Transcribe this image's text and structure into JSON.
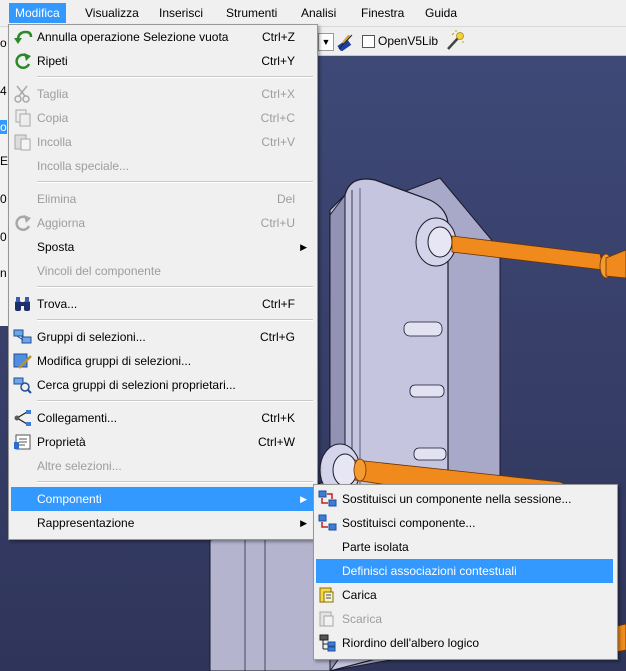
{
  "menubar": {
    "items": [
      "Modifica",
      "Visualizza",
      "Inserisci",
      "Strumenti",
      "Analisi",
      "Finestra",
      "Guida"
    ],
    "active": "Modifica"
  },
  "toolbar": {
    "checkbox_label": "OpenV5Lib",
    "checkbox_checked": false
  },
  "left_strip_chars": [
    "o",
    "4",
    "o",
    "E",
    "0",
    "0",
    "n"
  ],
  "menu": {
    "items": [
      {
        "label": "Annulla operazione Selezione vuota",
        "shortcut": "Ctrl+Z",
        "icon": "undo-icon",
        "enabled": true
      },
      {
        "label": "Ripeti",
        "shortcut": "Ctrl+Y",
        "icon": "redo-icon",
        "enabled": true
      },
      {
        "label": "Taglia",
        "shortcut": "Ctrl+X",
        "icon": "scissors-icon",
        "enabled": false
      },
      {
        "label": "Copia",
        "shortcut": "Ctrl+C",
        "icon": "copy-icon",
        "enabled": false
      },
      {
        "label": "Incolla",
        "shortcut": "Ctrl+V",
        "icon": "paste-icon",
        "enabled": false
      },
      {
        "label": "Incolla speciale...",
        "shortcut": "",
        "icon": "",
        "enabled": false
      },
      {
        "label": "Elimina",
        "shortcut": "Del",
        "icon": "",
        "enabled": false
      },
      {
        "label": "Aggiorna",
        "shortcut": "Ctrl+U",
        "icon": "update-icon",
        "enabled": false
      },
      {
        "label": "Sposta",
        "shortcut": "",
        "icon": "",
        "enabled": true,
        "submenu": true
      },
      {
        "label": "Vincoli del componente",
        "shortcut": "",
        "icon": "",
        "enabled": false
      },
      {
        "label": "Trova...",
        "shortcut": "Ctrl+F",
        "icon": "binoculars-icon",
        "enabled": true
      },
      {
        "label": "Gruppi di selezioni...",
        "shortcut": "Ctrl+G",
        "icon": "selection-sets-icon",
        "enabled": true
      },
      {
        "label": "Modifica gruppi di selezioni...",
        "shortcut": "",
        "icon": "edit-selection-sets-icon",
        "enabled": true
      },
      {
        "label": "Cerca gruppi di selezioni proprietari...",
        "shortcut": "",
        "icon": "search-selection-sets-icon",
        "enabled": true
      },
      {
        "label": "Collegamenti...",
        "shortcut": "Ctrl+K",
        "icon": "links-icon",
        "enabled": true
      },
      {
        "label": "Proprietà",
        "shortcut": "Ctrl+W",
        "icon": "properties-icon",
        "enabled": true
      },
      {
        "label": "Altre selezioni...",
        "shortcut": "",
        "icon": "",
        "enabled": false
      },
      {
        "label": "Componenti",
        "shortcut": "",
        "icon": "",
        "enabled": true,
        "submenu": true,
        "highlighted": true
      },
      {
        "label": "Rappresentazione",
        "shortcut": "",
        "icon": "",
        "enabled": true,
        "submenu": true
      }
    ]
  },
  "submenu": {
    "items": [
      {
        "label": "Sostituisci un componente nella sessione...",
        "icon": "replace-session-icon",
        "enabled": true
      },
      {
        "label": "Sostituisci componente...",
        "icon": "replace-component-icon",
        "enabled": true
      },
      {
        "label": "Parte isolata",
        "icon": "",
        "enabled": true
      },
      {
        "label": "Definisci associazioni contestuali",
        "icon": "",
        "enabled": true,
        "highlighted": true
      },
      {
        "label": "Carica",
        "icon": "load-icon",
        "enabled": true
      },
      {
        "label": "Scarica",
        "icon": "unload-icon",
        "enabled": false
      },
      {
        "label": "Riordino dell'albero logico",
        "icon": "reorder-tree-icon",
        "enabled": true
      }
    ]
  },
  "colors": {
    "menu_highlight": "#3399ff",
    "menu_background": "#f0f0f0",
    "disabled_text": "#9d9d9d",
    "viewport_background": "#3a4270",
    "rod_color": "#f08a1c"
  }
}
